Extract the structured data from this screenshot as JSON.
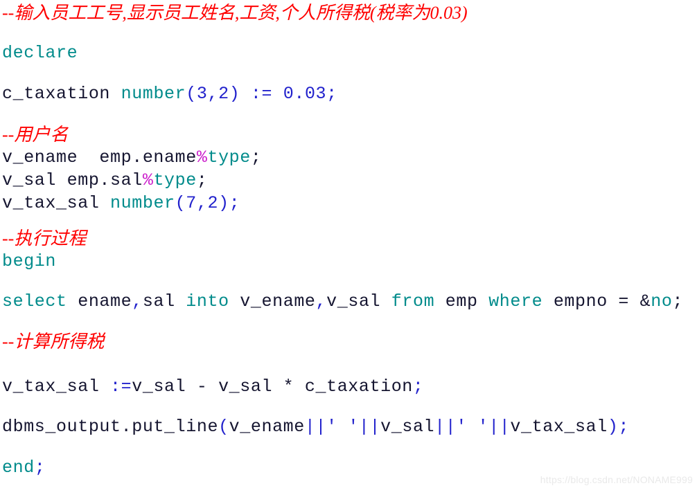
{
  "document": {
    "type": "code-snippet",
    "language": "PL/SQL",
    "background_color": "#ffffff",
    "colors": {
      "comment": "#ff0000",
      "keyword": "#008b8b",
      "identifier": "#151530",
      "punctuation": "#2222cc",
      "number": "#2222cc",
      "percent": "#cc22cc",
      "string": "#2222cc",
      "watermark": "#e9e9e9"
    }
  },
  "lines": {
    "l1_comment_header": "--输入员工工号,显示员工姓名,工资,个人所得税(税率为0.03)",
    "l2_declare": "declare",
    "l3_const_name": "c_taxation ",
    "l3_const_type": "number",
    "l3_const_open": "(",
    "l3_const_prec": "3",
    "l3_const_comma": ",",
    "l3_const_scale": "2",
    "l3_const_close": ")",
    "l3_const_assign": " := ",
    "l3_const_value": "0.03",
    "l3_const_semi": ";",
    "l4_comment_username": "--用户名",
    "l5_var_ename": "v_ename  emp.ename",
    "l5_var_ename_pct": "%",
    "l5_var_ename_type": "type",
    "l5_var_ename_semi": ";",
    "l6_var_sal": "v_sal emp.sal",
    "l6_var_sal_pct": "%",
    "l6_var_sal_type": "type",
    "l6_var_sal_semi": ";",
    "l7_var_tax": "v_tax_sal ",
    "l7_var_tax_type": "number",
    "l7_var_tax_open": "(",
    "l7_var_tax_prec": "7",
    "l7_var_tax_comma": ",",
    "l7_var_tax_scale": "2",
    "l7_var_tax_close": ")",
    "l7_var_tax_semi": ";",
    "l8_comment_process": "--执行过程",
    "l9_begin": "begin",
    "l10_select_kw": "select",
    "l10_select_cols_a": " ename",
    "l10_select_comma1": ",",
    "l10_select_cols_b": "sal ",
    "l10_into_kw": "into",
    "l10_into_vars_a": " v_ename",
    "l10_select_comma2": ",",
    "l10_into_vars_b": "v_sal ",
    "l10_from_kw": "from",
    "l10_from_table": " emp ",
    "l10_where_kw": "where",
    "l10_where_col": " empno = ",
    "l10_bind_amp": "&",
    "l10_bind_name": "no",
    "l10_where_semi": ";",
    "l11_comment_tax": "--计算所得税",
    "l12_assign_lhs": "v_tax_sal ",
    "l12_assign_op": ":=",
    "l12_assign_rhs": "v_sal - v_sal * c_taxation",
    "l12_assign_semi": ";",
    "l13_out_call": "dbms_output.put_line",
    "l13_out_open": "(",
    "l13_out_arg1": "v_ename",
    "l13_out_cat1": "||",
    "l13_out_str1": "' '",
    "l13_out_cat2": "||",
    "l13_out_arg2": "v_sal",
    "l13_out_cat3": "||",
    "l13_out_str2": "' '",
    "l13_out_cat4": "||",
    "l13_out_arg3": "v_tax_sal",
    "l13_out_close": ")",
    "l13_out_semi": ";",
    "l14_end": "end",
    "l14_end_semi": ";"
  },
  "watermark": {
    "text": "https://blog.csdn.net/NONAME999"
  }
}
